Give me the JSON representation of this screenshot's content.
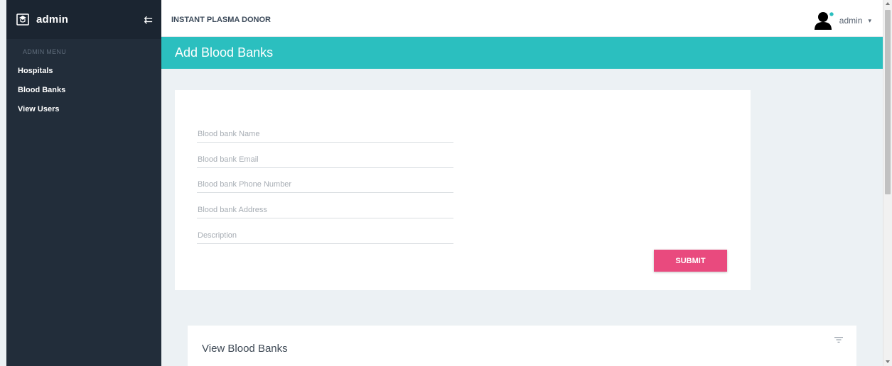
{
  "sidebar": {
    "brand": "admin",
    "brand_icon": "graduation-cap-icon",
    "collapse_icon": "collapse-arrow-icon",
    "menu_title": "ADMIN MENU",
    "items": [
      {
        "label": "Hospitals"
      },
      {
        "label": "Blood Banks"
      },
      {
        "label": "View Users"
      }
    ]
  },
  "header": {
    "app_title": "INSTANT PLASMA DONOR",
    "user_name": "admin",
    "user_caret": "▾",
    "avatar_icon": "user-avatar-icon"
  },
  "page": {
    "title": "Add Blood Banks"
  },
  "form": {
    "fields": [
      {
        "placeholder": "Blood bank Name",
        "value": ""
      },
      {
        "placeholder": "Blood bank Email",
        "value": ""
      },
      {
        "placeholder": "Blood bank Phone Number",
        "value": ""
      },
      {
        "placeholder": "Blood bank Address",
        "value": ""
      },
      {
        "placeholder": "Description",
        "value": ""
      }
    ],
    "submit_label": "SUBMIT"
  },
  "view_section": {
    "title": "View Blood Banks",
    "filter_icon": "filter-icon"
  },
  "colors": {
    "sidebar_bg": "#222d3a",
    "accent_teal": "#2bbfbf",
    "submit_pink": "#e94a7e",
    "page_bg": "#ecf1f4"
  }
}
